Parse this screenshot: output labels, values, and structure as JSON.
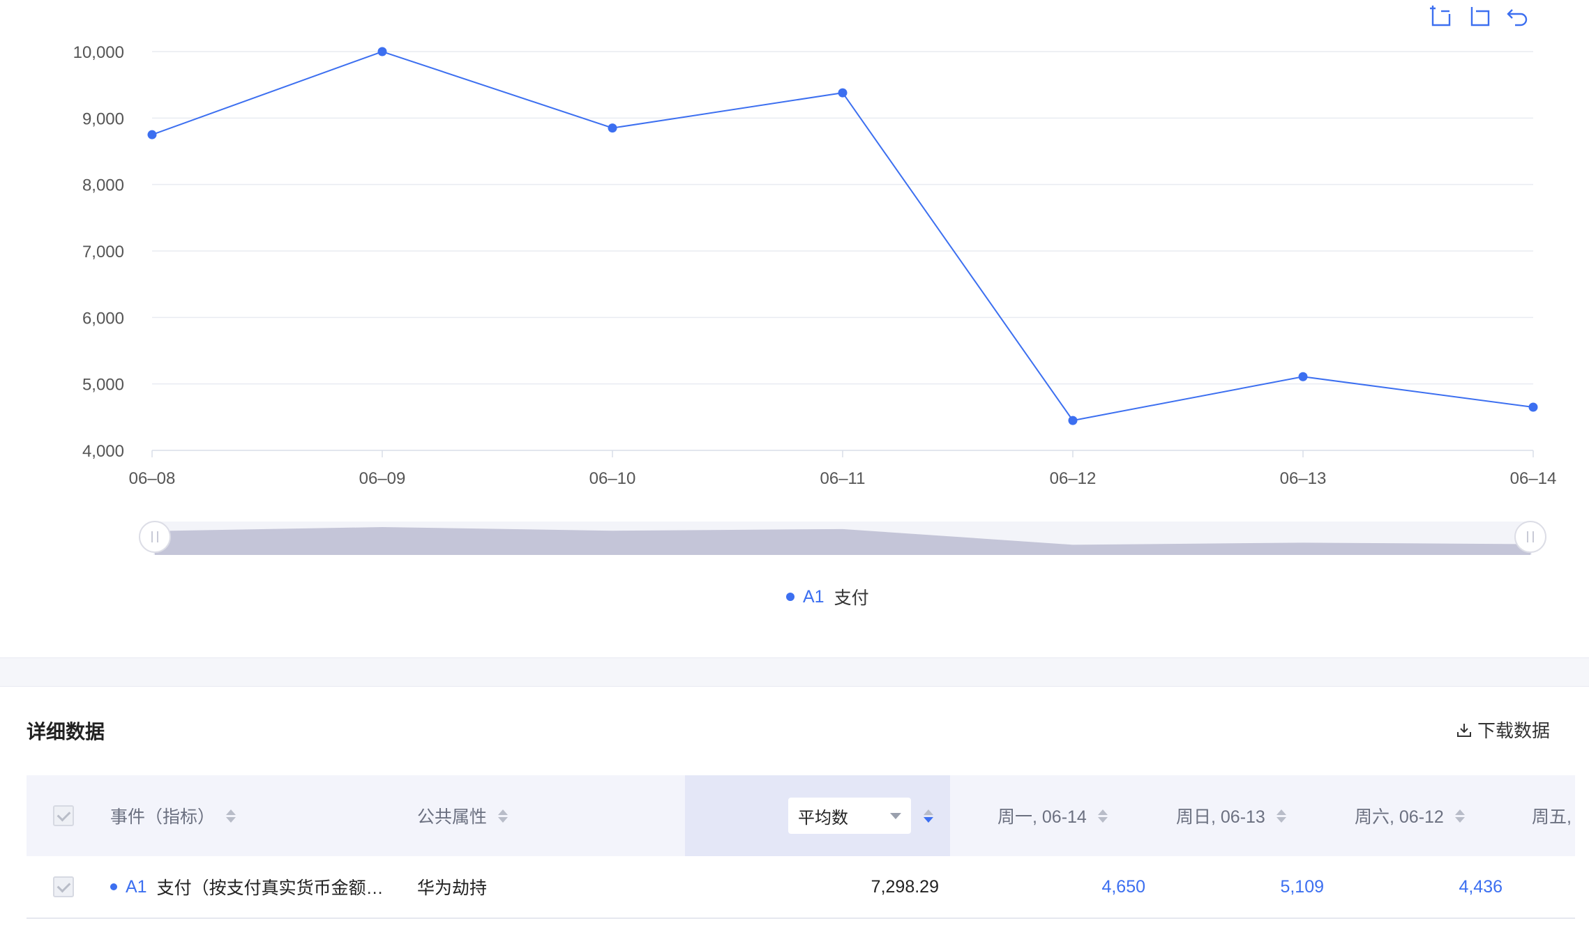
{
  "chart_data": {
    "type": "line",
    "categories": [
      "06–08",
      "06–09",
      "06–10",
      "06–11",
      "06–12",
      "06–13",
      "06–14"
    ],
    "series": [
      {
        "name": "支付",
        "code": "A1",
        "values": [
          8750,
          10000,
          8850,
          9380,
          4450,
          5109,
          4650
        ]
      }
    ],
    "y_ticks": [
      "4,000",
      "5,000",
      "6,000",
      "7,000",
      "8,000",
      "9,000",
      "10,000"
    ],
    "ylim": [
      4000,
      10000
    ],
    "grid": true,
    "legend_position": "bottom",
    "line_color": "#3c6ff0"
  },
  "toolbar": {
    "icons": [
      "zoom-area-icon",
      "zoom-reset-icon",
      "undo-icon"
    ]
  },
  "legend": {
    "code": "A1",
    "name": "支付"
  },
  "section": {
    "title": "详细数据",
    "download_label": "下载数据"
  },
  "table": {
    "headers": {
      "event": "事件（指标）",
      "property": "公共属性",
      "aggregate": "平均数",
      "d1": "周一, 06-14",
      "d2": "周日, 06-13",
      "d3": "周六, 06-12",
      "d4": "周五,"
    },
    "rows": [
      {
        "code": "A1",
        "event": "支付（按支付真实货币金额…",
        "property": "华为劫持",
        "avg": "7,298.29",
        "d1": "4,650",
        "d2": "5,109",
        "d3": "4,436"
      }
    ]
  }
}
